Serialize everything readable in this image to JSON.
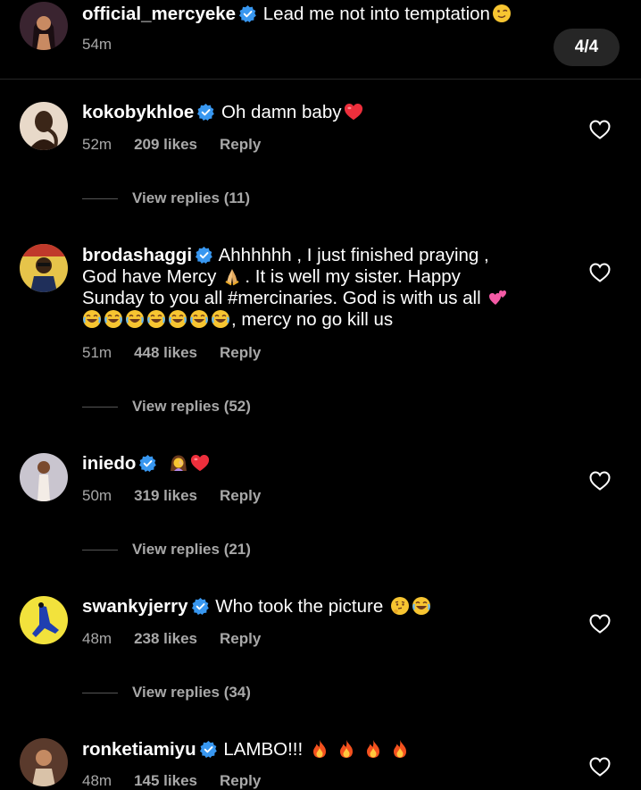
{
  "counter": "4/4",
  "post": {
    "username": "official_mercyeke",
    "text": "Lead me not into temptation",
    "time": "54m"
  },
  "comments": [
    {
      "username": "kokobykhloe",
      "text": "Oh damn baby",
      "time": "52m",
      "likes": "209 likes",
      "reply": "Reply",
      "view_replies": "View replies (11)"
    },
    {
      "username": "brodashaggi",
      "text_line1": "Ahhhhhh , I just finished praying ,",
      "text_line2a": "God have Mercy",
      "text_line2b": ". It is well my sister. Happy",
      "text_line3": "Sunday to you all #mercinaries. God is with us all",
      "text_line4": ", mercy no go kill us",
      "time": "51m",
      "likes": "448 likes",
      "reply": "Reply",
      "view_replies": "View replies (52)"
    },
    {
      "username": "iniedo",
      "text": "",
      "time": "50m",
      "likes": "319 likes",
      "reply": "Reply",
      "view_replies": "View replies (21)"
    },
    {
      "username": "swankyjerry",
      "text": "Who took the picture",
      "time": "48m",
      "likes": "238 likes",
      "reply": "Reply",
      "view_replies": "View replies (34)"
    },
    {
      "username": "ronketiamiyu",
      "text": "LAMBO!!!",
      "time": "48m",
      "likes": "145 likes",
      "reply": "Reply"
    }
  ],
  "icons": {
    "verified": "verified-badge-icon",
    "like": "heart-outline-icon"
  },
  "colors": {
    "background": "#000000",
    "verified_blue": "#3897f0",
    "meta_gray": "#a8a8a8",
    "heart_red": "#ed2f3c"
  }
}
